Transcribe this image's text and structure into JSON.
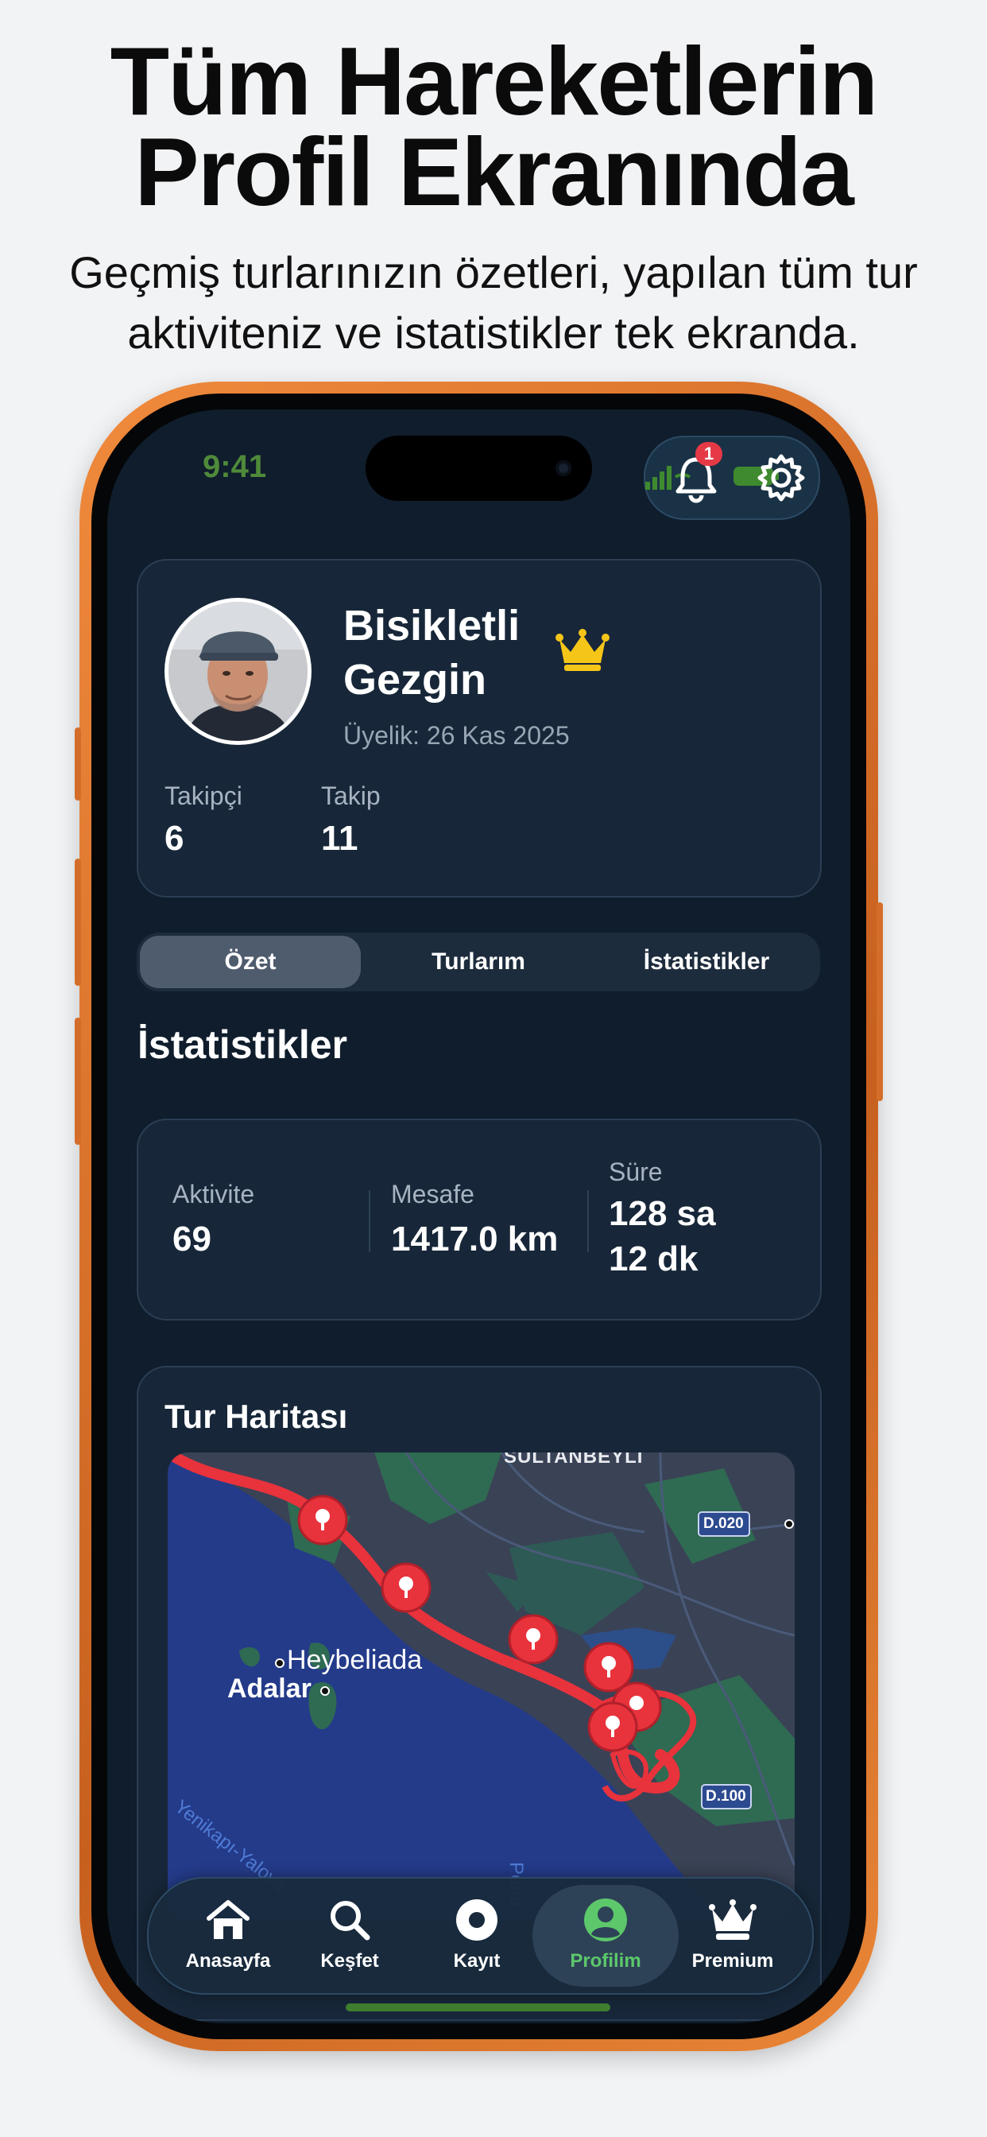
{
  "promo": {
    "headline": "Tüm Hareketlerin Profil Ekranında",
    "subtitle": "Geçmiş turlarınızın özetleri, yapılan tüm tur aktiviteniz ve istatistikler tek ekranda."
  },
  "status_bar": {
    "time": "9:41",
    "notification_count": "1"
  },
  "profile": {
    "name": "Bisikletli Gezgin",
    "membership": "Üyelik: 26 Kas 2025",
    "followers_label": "Takipçi",
    "followers_value": "6",
    "following_label": "Takip",
    "following_value": "11",
    "badge_icon": "crown-icon",
    "badge_color": "#f5c518"
  },
  "tabs": {
    "items": [
      "Özet",
      "Turlarım",
      "İstatistikler"
    ],
    "active": "Özet"
  },
  "stats": {
    "title": "İstatistikler",
    "activity_label": "Aktivite",
    "activity_value": "69",
    "distance_label": "Mesafe",
    "distance_value": "1417.0 km",
    "duration_label": "Süre",
    "duration_value_1": "128 sa",
    "duration_value_2": "12 dk"
  },
  "map": {
    "title": "Tur Haritası",
    "labels": {
      "sultanbeyli": "SULTANBEYLI",
      "heybeliada": "Heybeliada",
      "adalar": "Adalar",
      "ferry": "Yenikapı-Yalova",
      "pendik": "Pend",
      "road1": "D.020",
      "road2": "D.100"
    },
    "route_color": "#e8323c"
  },
  "bottom_nav": {
    "items": [
      {
        "label": "Anasayfa",
        "icon": "home-icon"
      },
      {
        "label": "Keşfet",
        "icon": "search-icon"
      },
      {
        "label": "Kayıt",
        "icon": "record-icon"
      },
      {
        "label": "Profilim",
        "icon": "profile-icon"
      },
      {
        "label": "Premium",
        "icon": "crown-icon"
      }
    ],
    "active": "Profilim",
    "active_color": "#5cc86b"
  },
  "colors": {
    "screen_bg": "#0f1d2c",
    "card_bg": "#172739",
    "frame": "#e07a30"
  }
}
